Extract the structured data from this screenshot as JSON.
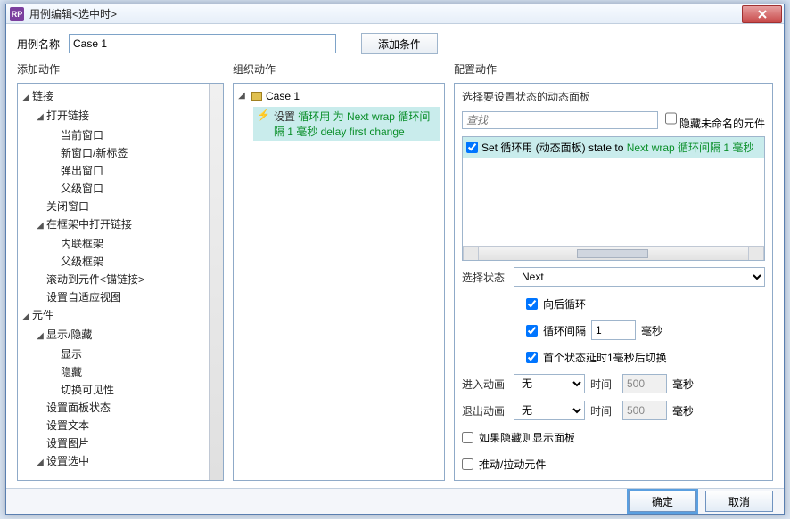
{
  "titlebar": {
    "icon": "RP",
    "text": "用例编辑<选中时>"
  },
  "top": {
    "label": "用例名称",
    "value": "Case 1",
    "add_condition": "添加条件"
  },
  "columns": {
    "left": "添加动作",
    "mid": "组织动作",
    "right": "配置动作"
  },
  "actions_tree": [
    {
      "label": "链接",
      "depth": 0,
      "exp": true
    },
    {
      "label": "打开链接",
      "depth": 1,
      "exp": true
    },
    {
      "label": "当前窗口",
      "depth": 2
    },
    {
      "label": "新窗口/新标签",
      "depth": 2
    },
    {
      "label": "弹出窗口",
      "depth": 2
    },
    {
      "label": "父级窗口",
      "depth": 2
    },
    {
      "label": "关闭窗口",
      "depth": 1
    },
    {
      "label": "在框架中打开链接",
      "depth": 1,
      "exp": true
    },
    {
      "label": "内联框架",
      "depth": 2
    },
    {
      "label": "父级框架",
      "depth": 2
    },
    {
      "label": "滚动到元件<锚链接>",
      "depth": 1
    },
    {
      "label": "设置自适应视图",
      "depth": 1
    },
    {
      "label": "元件",
      "depth": 0,
      "exp": true
    },
    {
      "label": "显示/隐藏",
      "depth": 1,
      "exp": true
    },
    {
      "label": "显示",
      "depth": 2
    },
    {
      "label": "隐藏",
      "depth": 2
    },
    {
      "label": "切换可见性",
      "depth": 2
    },
    {
      "label": "设置面板状态",
      "depth": 1
    },
    {
      "label": "设置文本",
      "depth": 1
    },
    {
      "label": "设置图片",
      "depth": 1
    },
    {
      "label": "设置选中",
      "depth": 1,
      "exp": true
    }
  ],
  "mid": {
    "case": "Case 1",
    "action_pre": "设置 ",
    "action_green": "循环用 为 Next wrap 循环间隔 1 毫秒 delay first change"
  },
  "cfg": {
    "header": "选择要设置状态的动态面板",
    "search_placeholder": "查找",
    "hide_unnamed": "隐藏未命名的元件",
    "item_pre": "Set 循环用 (动态面板) state to ",
    "item_green": "Next wrap 循环间隔 1 毫秒",
    "sel_state_label": "选择状态",
    "sel_state_value": "Next",
    "wrap_back": "向后循环",
    "loop_interval_label": "循环间隔",
    "loop_interval_value": "1",
    "ms": "毫秒",
    "delay_first": "首个状态延时1毫秒后切换",
    "enter_anim_label": "进入动画",
    "exit_anim_label": "退出动画",
    "anim_none": "无",
    "time_label": "时间",
    "time_value": "500",
    "show_if_hidden": "如果隐藏则显示面板",
    "push_pull": "推动/拉动元件"
  },
  "footer": {
    "ok": "确定",
    "cancel": "取消"
  }
}
